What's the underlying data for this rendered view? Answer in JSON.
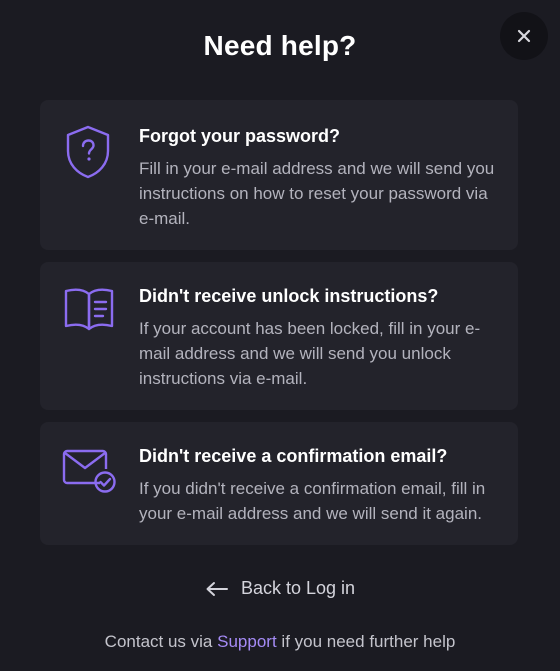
{
  "dialog": {
    "title": "Need help?",
    "close_icon": "close-icon"
  },
  "options": [
    {
      "icon": "shield-question-icon",
      "title": "Forgot your password?",
      "text": "Fill in your e-mail address and we will send you instructions on how to reset your password via e-mail."
    },
    {
      "icon": "open-book-icon",
      "title": "Didn't receive unlock instructions?",
      "text": "If your account has been locked, fill in your e-mail address and we will send you unlock instructions via e-mail."
    },
    {
      "icon": "envelope-check-icon",
      "title": "Didn't receive a confirmation email?",
      "text": "If you didn't receive a confirmation email, fill in your e-mail address and we will send it again."
    }
  ],
  "back_link": {
    "icon": "arrow-left-icon",
    "label": "Back to Log in"
  },
  "footer": {
    "prefix": "Contact us via",
    "link": "Support",
    "suffix": "if you need further help"
  },
  "colors": {
    "background": "#1b1b22",
    "card": "#23232b",
    "accent": "#8b6cf0",
    "link": "#a58bf6"
  }
}
